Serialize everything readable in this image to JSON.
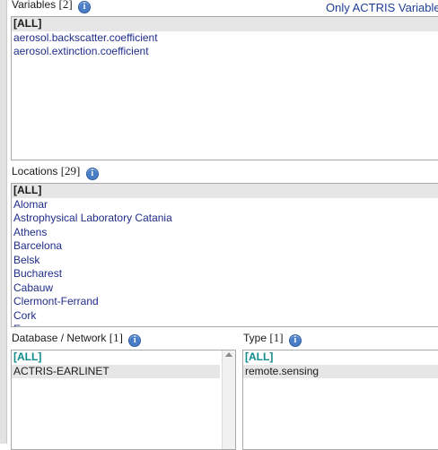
{
  "variables": {
    "label": "Variables",
    "count": "[2]",
    "only_link": "Only ACTRIS Variable",
    "items": [
      "[ALL]",
      "aerosol.backscatter.coefficient",
      "aerosol.extinction.coefficient"
    ]
  },
  "locations": {
    "label": "Locations",
    "count": "[29]",
    "items": [
      "[ALL]",
      "Alomar",
      "Astrophysical Laboratory Catania",
      "Athens",
      "Barcelona",
      "Belsk",
      "Bucharest",
      "Cabauw",
      "Clermont-Ferrand",
      "Cork",
      "E"
    ]
  },
  "database": {
    "label": "Database / Network",
    "count": "[1]",
    "items": [
      "[ALL]",
      "ACTRIS-EARLINET"
    ]
  },
  "type": {
    "label": "Type",
    "count": "[1]",
    "items": [
      "[ALL]",
      "remote.sensing"
    ]
  },
  "colors": {
    "link": "#1f2d8a",
    "all_teal": "#0d8a8a",
    "selected_bg": "#e6e6e6"
  },
  "icons": {
    "info": "info-icon",
    "scroll_up": "chevron-up-icon"
  }
}
